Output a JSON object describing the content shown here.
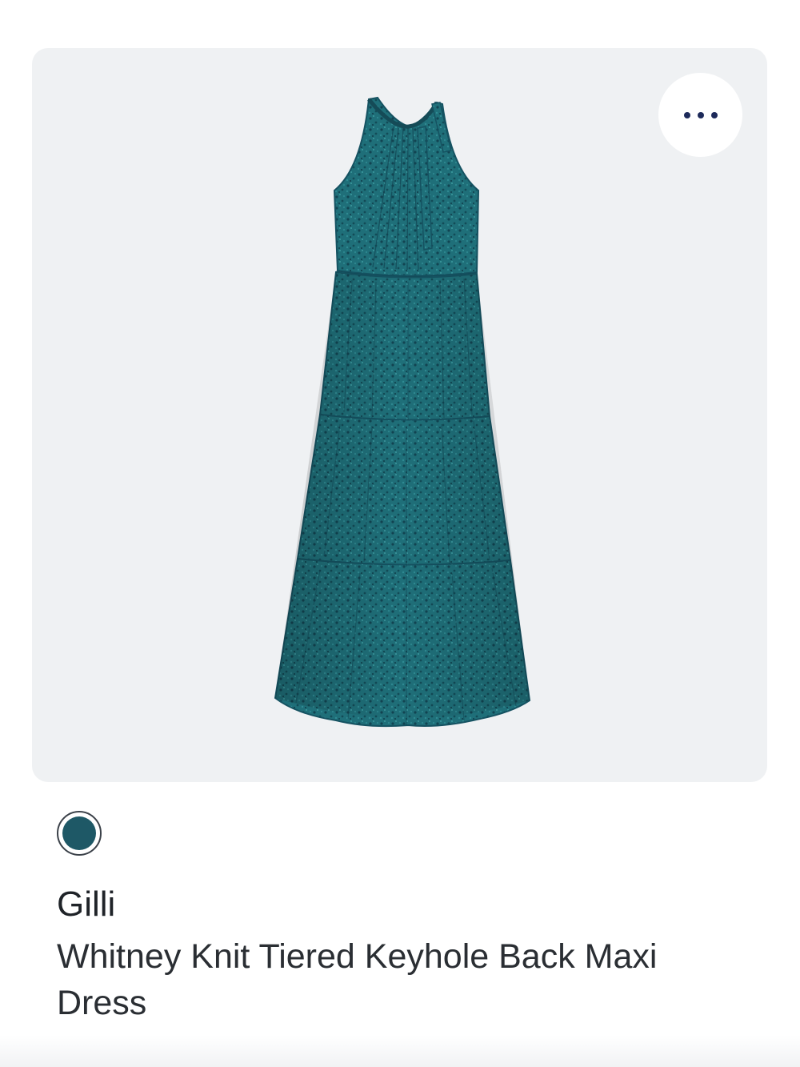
{
  "product_card": {
    "image_alt": "Whitney Knit Tiered Keyhole Back Maxi Dress",
    "more_icon": "more-horizontal-icon",
    "swatches": [
      {
        "color": "#1e5866",
        "selected": true
      }
    ],
    "brand": "Gilli",
    "name": "Whitney Knit Tiered Keyhole Back Maxi Dress"
  },
  "colors": {
    "card_background": "#eff1f3",
    "dress_base": "#1f6f79",
    "dress_dark": "#17515d",
    "dots_icon": "#1d2a5a"
  }
}
